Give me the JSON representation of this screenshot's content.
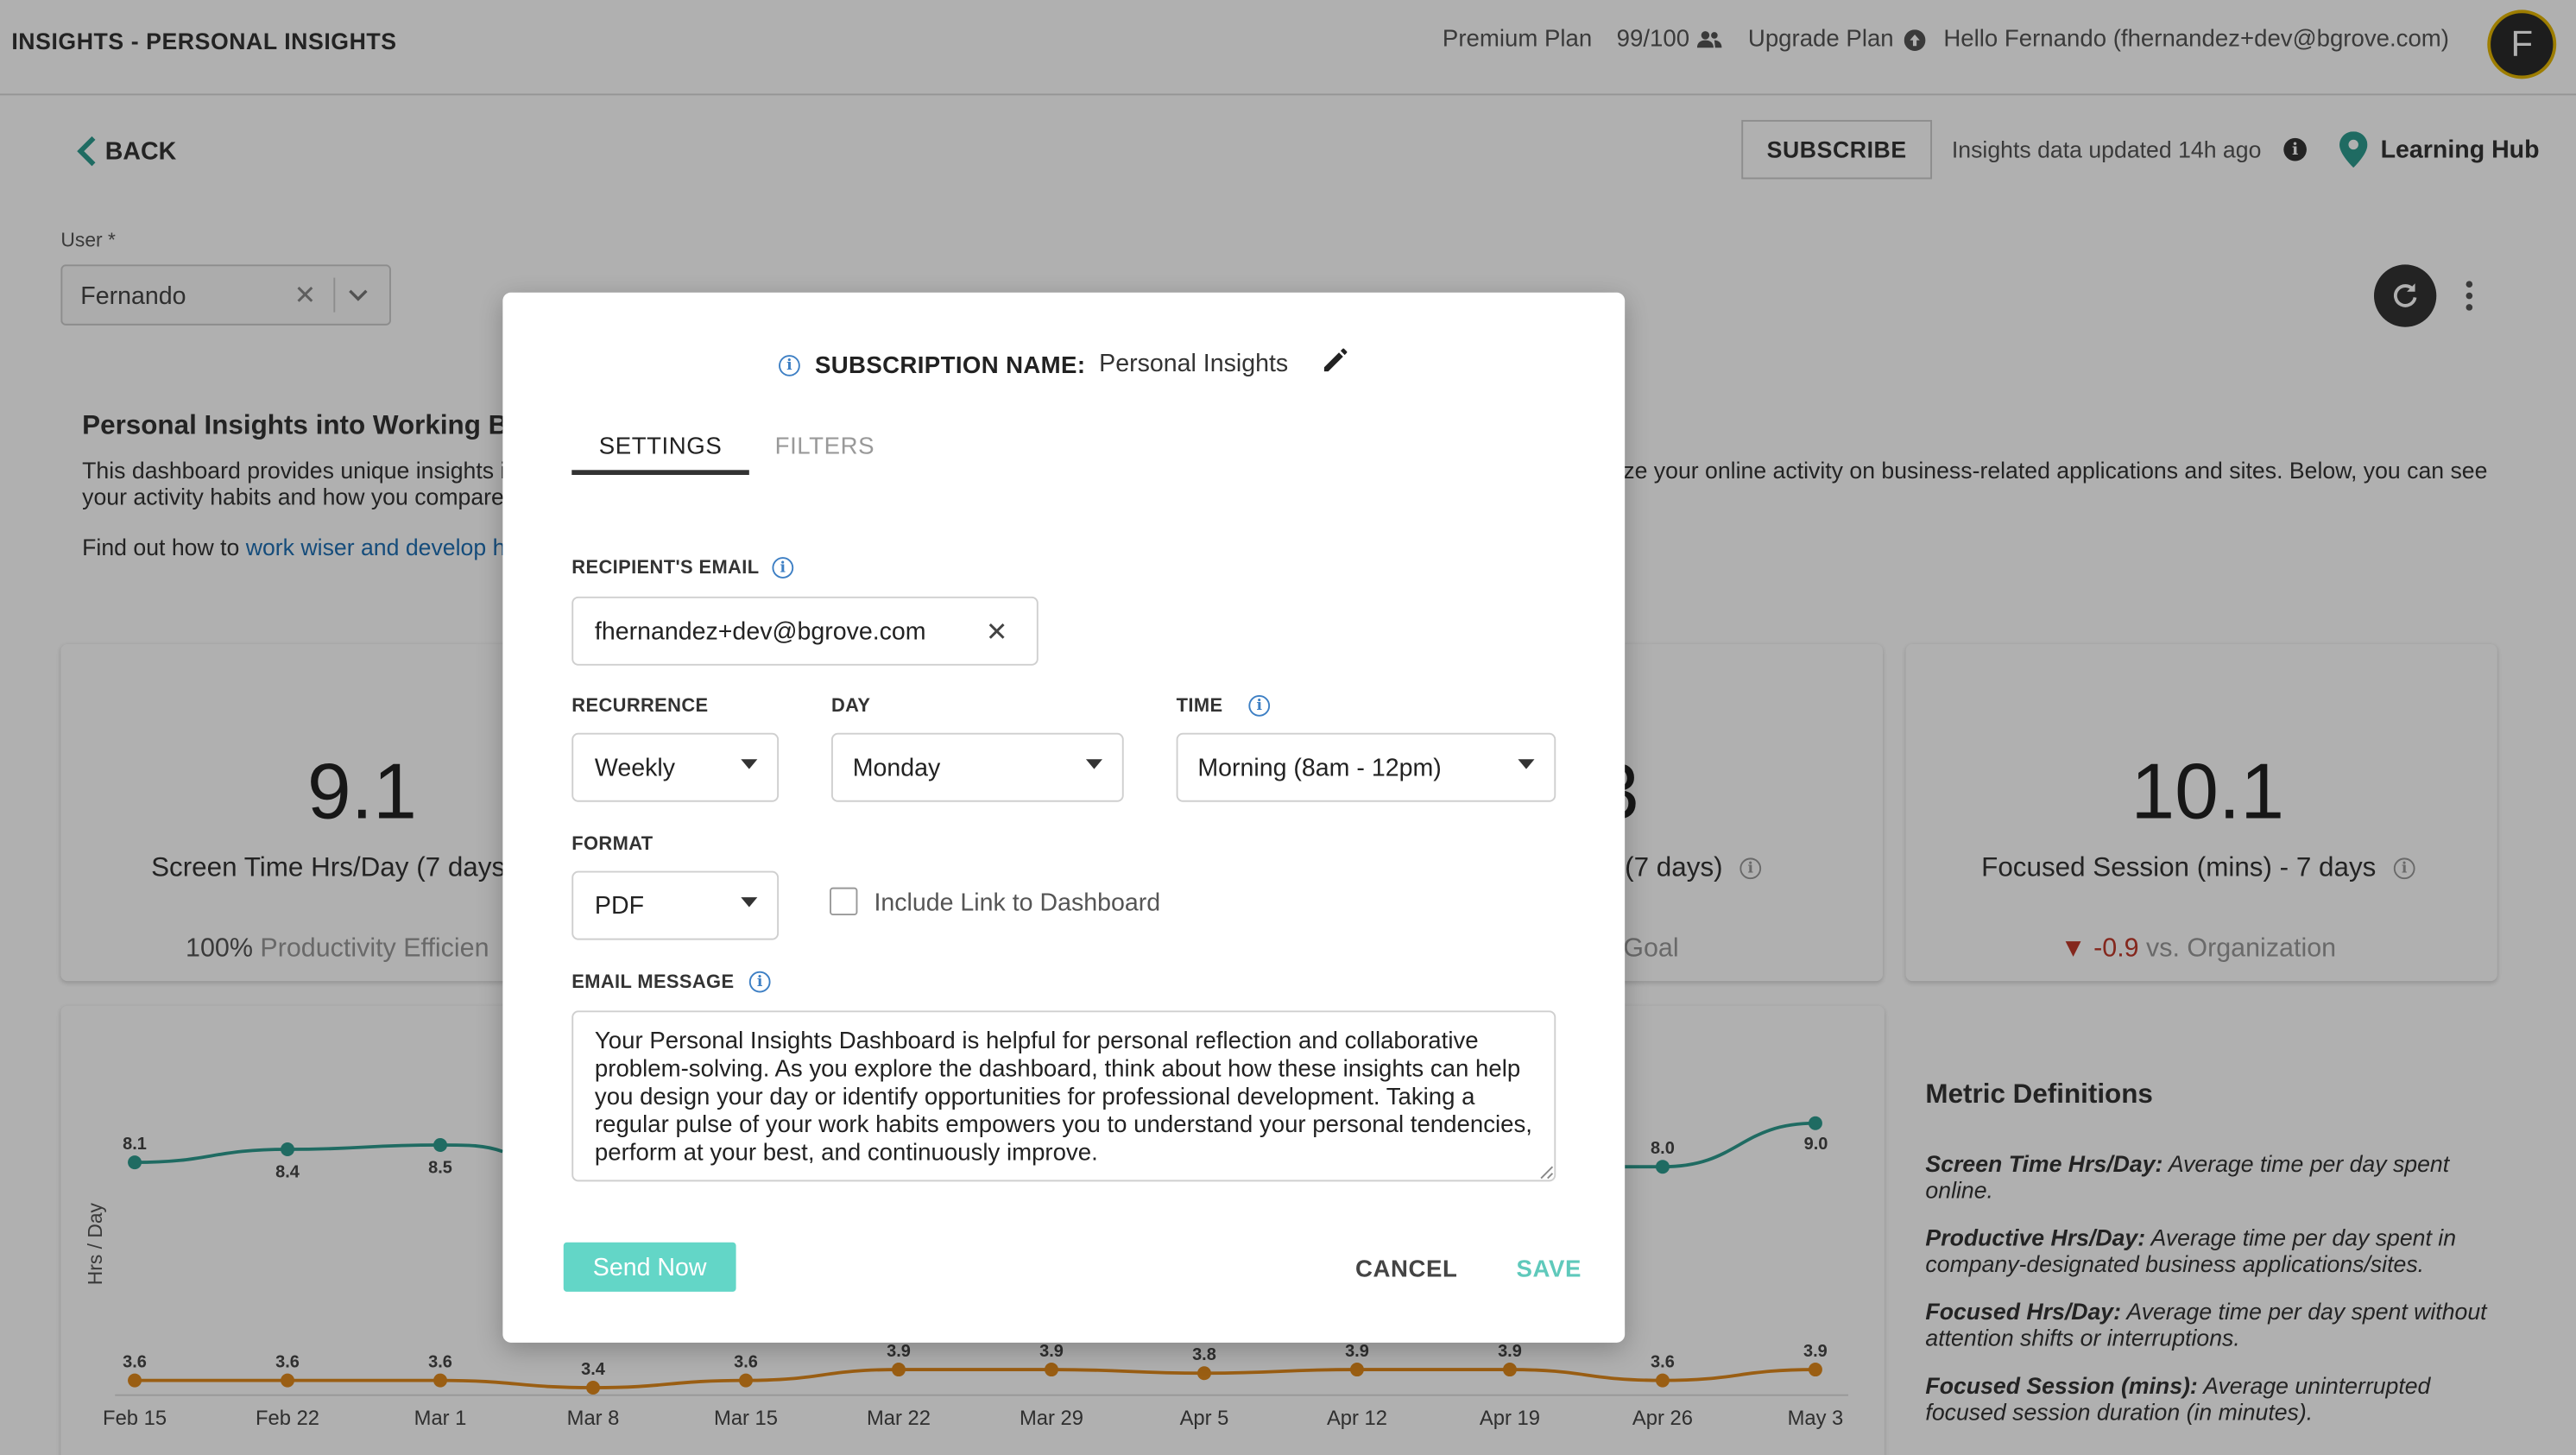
{
  "header": {
    "app_title": "INSIGHTS - PERSONAL INSIGHTS",
    "plan": "Premium Plan",
    "seats": "99/100",
    "upgrade": "Upgrade Plan",
    "greeting": "Hello Fernando (fhernandez+dev@bgrove.com)",
    "avatar_initial": "F"
  },
  "toolbar": {
    "back_label": "BACK",
    "subscribe_label": "SUBSCRIBE",
    "updated_text": "Insights data updated 14h ago",
    "learning_hub": "Learning Hub"
  },
  "user_filter": {
    "label": "User *",
    "value": "Fernando"
  },
  "intro": {
    "heading": "Personal Insights into Working Be",
    "line1_left": "This dashboard provides unique insights i",
    "line1_right": "ze your online activity on business-related applications and sites. Below, you can see",
    "line2": "your activity habits and how you compare",
    "line3_prefix": "Find out how to ",
    "line3_link": "work wiser and develop he"
  },
  "metrics": [
    {
      "value": "9.1",
      "title": "Screen Time Hrs/Day (7 days",
      "foot_bold": "100%",
      "foot": " Productivity Efficien"
    },
    {
      "value": "3",
      "title": "(7 days)",
      "foot": "Goal"
    },
    {
      "value": "10.1",
      "title": "Focused Session (mins) - 7 days",
      "foot_delta": "-0.9",
      "foot": " vs. Organization"
    }
  ],
  "chart_data": {
    "type": "line",
    "ylabel": "Hrs / Day",
    "categories": [
      "Feb 15",
      "Feb 22",
      "Mar 1",
      "Mar 8",
      "Mar 15",
      "Mar 22",
      "Mar 29",
      "Apr 5",
      "Apr 12",
      "Apr 19",
      "Apr 26",
      "May 3"
    ],
    "series": [
      {
        "color": "#2e9c8f",
        "values": [
          8.1,
          8.4,
          8.5,
          null,
          null,
          null,
          null,
          null,
          null,
          null,
          8.0,
          9.0
        ]
      },
      {
        "color": "#e0891c",
        "values": [
          3.6,
          3.6,
          3.6,
          3.4,
          3.6,
          3.9,
          3.9,
          3.8,
          3.9,
          3.9,
          3.6,
          3.9
        ]
      }
    ]
  },
  "definitions": {
    "title": "Metric Definitions",
    "items": [
      {
        "term": "Screen Time Hrs/Day:",
        "desc": " Average time per day spent online."
      },
      {
        "term": "Productive Hrs/Day:",
        "desc": " Average time per day spent in company-designated business applications/sites."
      },
      {
        "term": "Focused Hrs/Day:",
        "desc": " Average time per day spent without attention shifts or interruptions."
      },
      {
        "term": "Focused Session (mins):",
        "desc": " Average uninterrupted focused session duration (in minutes)."
      }
    ]
  },
  "modal": {
    "name_label": "SUBSCRIPTION NAME:",
    "name_value": "Personal Insights",
    "tabs": [
      "SETTINGS",
      "FILTERS"
    ],
    "email_label": "RECIPIENT'S EMAIL",
    "email_value": "fhernandez+dev@bgrove.com",
    "recurrence_label": "RECURRENCE",
    "recurrence_value": "Weekly",
    "day_label": "DAY",
    "day_value": "Monday",
    "time_label": "TIME",
    "time_value": "Morning (8am - 12pm)",
    "format_label": "FORMAT",
    "format_value": "PDF",
    "include_link_label": "Include Link to Dashboard",
    "message_label": "EMAIL MESSAGE",
    "message_value": "Your Personal Insights Dashboard is helpful for personal reflection and collaborative problem-solving. As you explore the dashboard, think about how these insights can help you design your day or identify opportunities for professional development. Taking a regular pulse of your work habits empowers you to understand your personal tendencies, perform at your best, and continuously improve.",
    "send_now": "Send Now",
    "cancel": "CANCEL",
    "save": "SAVE"
  }
}
